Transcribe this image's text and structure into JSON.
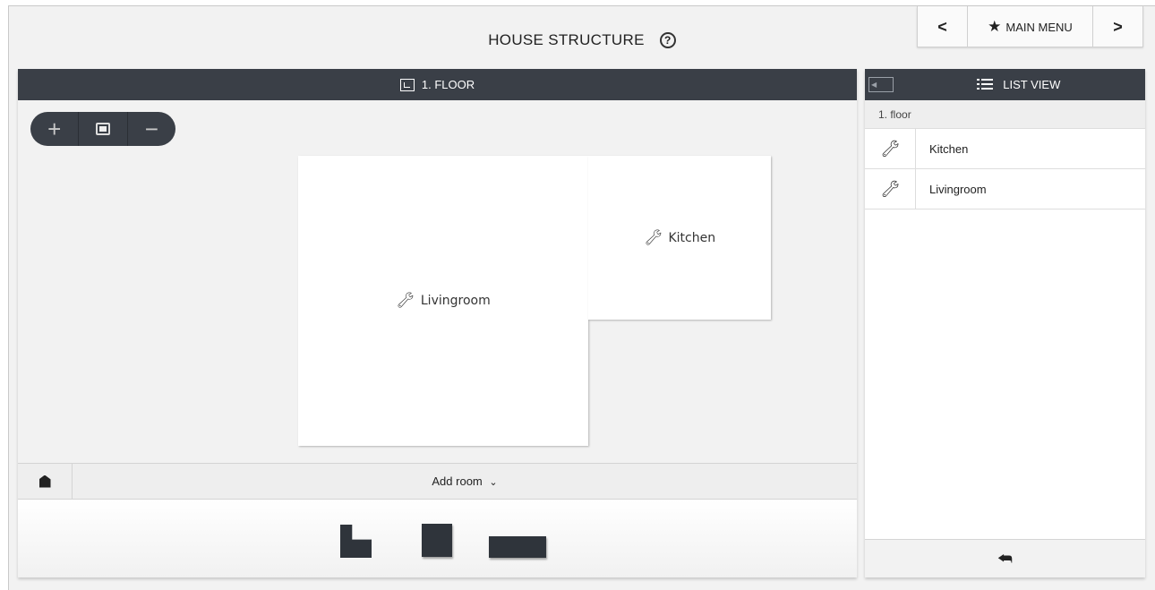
{
  "header": {
    "title": "HOUSE STRUCTURE",
    "help_icon": "help-circle-icon",
    "nav": {
      "prev": "<",
      "main_menu": "MAIN MENU",
      "main_menu_icon": "star-icon",
      "next": ">"
    }
  },
  "floor_panel": {
    "title": "1. FLOOR",
    "zoom": {
      "in": "+",
      "out": "−",
      "fit_icon": "fit-screen-icon"
    },
    "rooms": [
      {
        "name": "Livingroom",
        "icon": "wrench-icon"
      },
      {
        "name": "Kitchen",
        "icon": "wrench-icon"
      }
    ],
    "add_room": {
      "label": "Add room",
      "chevron": "⌄"
    },
    "room_shapes": [
      "l-shape-room",
      "square-room",
      "rectangle-room"
    ]
  },
  "list_panel": {
    "title": "LIST VIEW",
    "group": "1. floor",
    "items": [
      {
        "label": "Kitchen",
        "icon": "wrench-icon"
      },
      {
        "label": "Livingroom",
        "icon": "wrench-icon"
      }
    ],
    "back_icon": "back-arrow-icon"
  },
  "colors": {
    "bar_dark": "#3a3f47",
    "background": "#f2f2f2",
    "room_fill": "#ffffff",
    "shape_fill": "#2f343b"
  }
}
